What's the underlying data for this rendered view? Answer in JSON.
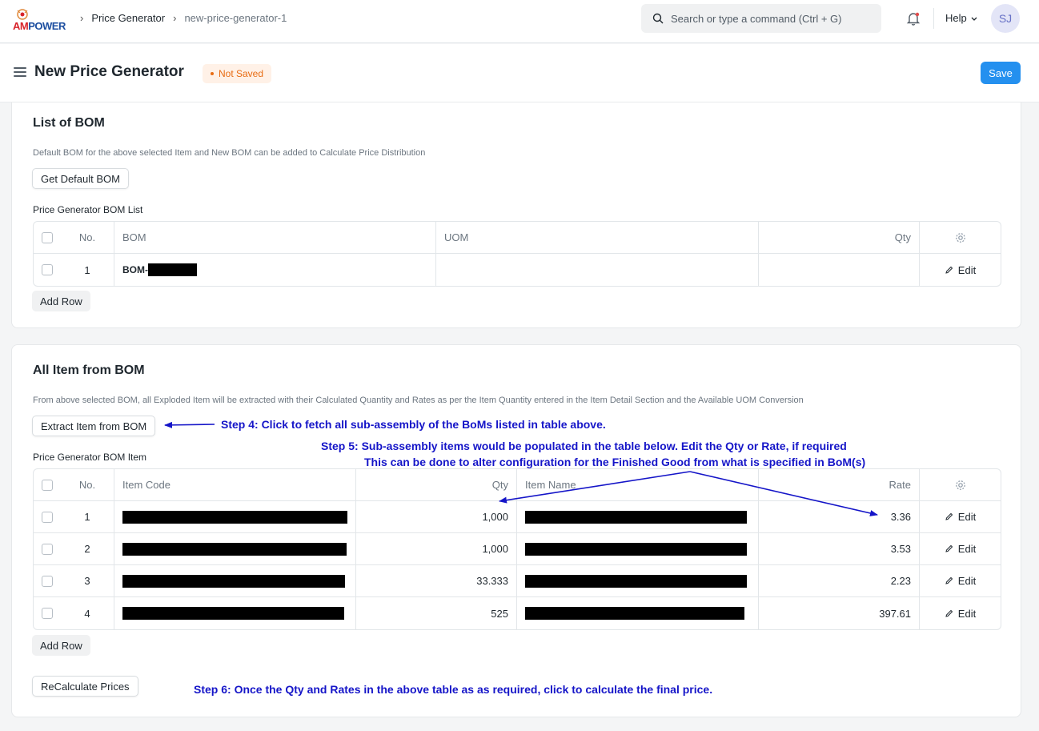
{
  "navbar": {
    "logo_prefix": "AM",
    "logo_suffix": "POWER",
    "breadcrumbs": [
      "Price Generator",
      "new-price-generator-1"
    ],
    "search_placeholder": "Search or type a command (Ctrl + G)",
    "help_label": "Help",
    "avatar_initials": "SJ"
  },
  "page": {
    "title": "New Price Generator",
    "status_badge": "Not Saved",
    "save_label": "Save"
  },
  "bom_section": {
    "title": "List of BOM",
    "description": "Default BOM for the above selected Item and New BOM can be added to Calculate Price Distribution",
    "get_default_label": "Get Default BOM",
    "table_label": "Price Generator BOM List",
    "headers": {
      "no": "No.",
      "bom": "BOM",
      "uom": "UOM",
      "qty": "Qty"
    },
    "rows": [
      {
        "no": "1",
        "bom": "BOM-",
        "uom": "",
        "qty": "",
        "edit": "Edit"
      }
    ],
    "add_row_label": "Add Row"
  },
  "item_section": {
    "title": "All Item from BOM",
    "description": "From above selected BOM, all Exploded Item will be extracted with their Calculated Quantity and Rates as per the Item Quantity entered in the Item Detail Section and the Available UOM Conversion",
    "extract_label": "Extract Item from BOM",
    "table_label": "Price Generator BOM Item",
    "headers": {
      "no": "No.",
      "item_code": "Item Code",
      "qty": "Qty",
      "item_name": "Item Name",
      "rate": "Rate"
    },
    "rows": [
      {
        "no": "1",
        "qty": "1,000",
        "rate": "3.36",
        "edit": "Edit"
      },
      {
        "no": "2",
        "qty": "1,000",
        "rate": "3.53",
        "edit": "Edit"
      },
      {
        "no": "3",
        "qty": "33.333",
        "rate": "2.23",
        "edit": "Edit"
      },
      {
        "no": "4",
        "qty": "525",
        "rate": "397.61",
        "edit": "Edit"
      }
    ],
    "add_row_label": "Add Row",
    "recalc_label": "ReCalculate Prices"
  },
  "annotations": {
    "step4": "Step 4: Click to fetch all sub-assembly of the BoMs listed in table above.",
    "step5_line1": "Step 5: Sub-assembly items would be populated in the table below. Edit the Qty or Rate, if required",
    "step5_line2": "This can be done to alter configuration for the Finished Good from what is specified in BoM(s)",
    "step6": "Step 6: Once the Qty and Rates in the above table as as required, click to calculate the final price."
  },
  "colors": {
    "primary": "#2490ef",
    "annotation": "#1515c8",
    "badge_text": "#e86c13",
    "badge_bg": "#fff1e7"
  }
}
